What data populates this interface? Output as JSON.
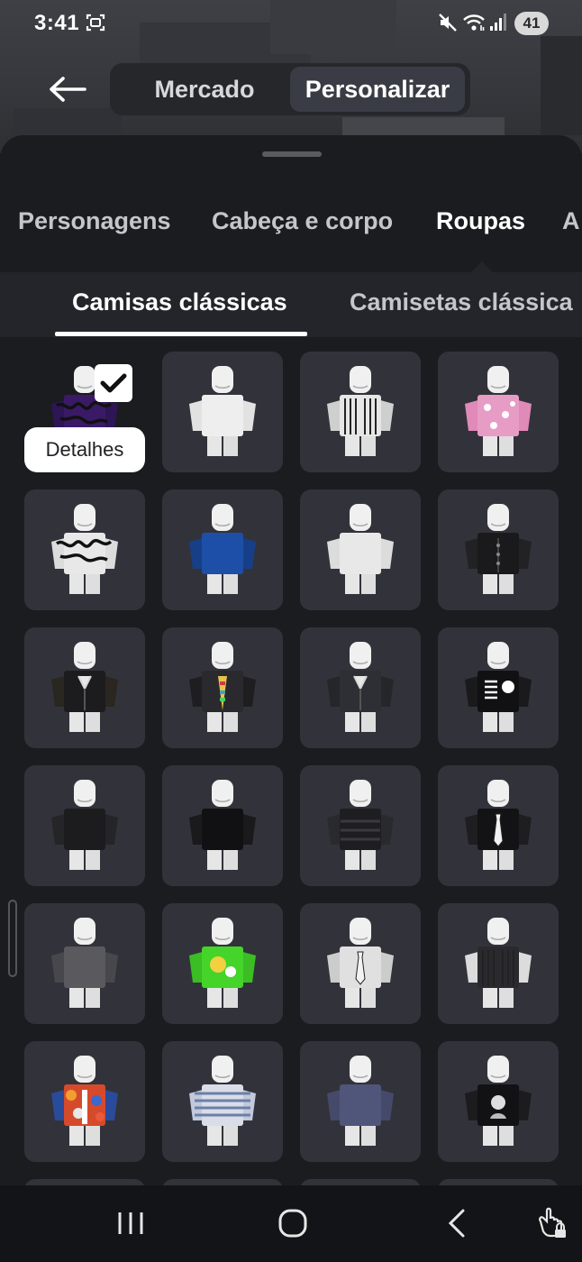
{
  "status_bar": {
    "time": "3:41",
    "battery": "41",
    "icons": [
      "screenshot-icon",
      "mute-icon",
      "wifi-icon",
      "signal-icon"
    ]
  },
  "header": {
    "tabs": [
      {
        "label": "Mercado",
        "active": false
      },
      {
        "label": "Personalizar",
        "active": true
      }
    ]
  },
  "categories": [
    {
      "label": "Personagens",
      "active": false
    },
    {
      "label": "Cabeça e corpo",
      "active": false
    },
    {
      "label": "Roupas",
      "active": true
    },
    {
      "label": "A",
      "active": false
    }
  ],
  "subcategories": [
    {
      "label": "Camisas clássicas",
      "active": true
    },
    {
      "label": "Camisetas clássica",
      "active": false
    }
  ],
  "tooltip": {
    "label": "Detalhes"
  },
  "items": [
    {
      "name": "purple-graffiti-shirt",
      "color": "#3a1a66",
      "arm": "#2e1555",
      "pattern": "graffiti",
      "selected": true
    },
    {
      "name": "plain-white-shirt",
      "color": "#eeeeee",
      "arm": "#e2e2e2",
      "pattern": "plain",
      "selected": false
    },
    {
      "name": "striped-bw-shirt",
      "color": "#e6e6e6",
      "arm": "#cfcfcf",
      "pattern": "stripes-dark",
      "selected": false
    },
    {
      "name": "pink-hello-kitty-shirt",
      "color": "#e79cc6",
      "arm": "#e08ab9",
      "pattern": "dots",
      "selected": false
    },
    {
      "name": "white-graffiti-shirt",
      "color": "#e8e8e8",
      "arm": "#dcdcdc",
      "pattern": "graffiti",
      "selected": false
    },
    {
      "name": "blue-jersey-shirt",
      "color": "#1e4fa8",
      "arm": "#173f88",
      "pattern": "plain",
      "selected": false
    },
    {
      "name": "white-henley-shirt",
      "color": "#e8e8e8",
      "arm": "#dcdcdc",
      "pattern": "plain",
      "selected": false
    },
    {
      "name": "black-cardigan-shirt",
      "color": "#1a1a1c",
      "arm": "#222225",
      "pattern": "buttons",
      "selected": false
    },
    {
      "name": "black-jacket-gold",
      "color": "#1c1c1e",
      "arm": "#2a2620",
      "pattern": "jacket",
      "selected": false
    },
    {
      "name": "black-leather-rainbow",
      "color": "#2a2a2e",
      "arm": "#1e1e20",
      "pattern": "rainbow",
      "selected": false
    },
    {
      "name": "dark-gray-jacket",
      "color": "#2e2f34",
      "arm": "#25262a",
      "pattern": "jacket",
      "selected": false
    },
    {
      "name": "real-men-kitty-shirt",
      "color": "#111113",
      "arm": "#1a1a1c",
      "pattern": "text",
      "selected": false
    },
    {
      "name": "black-hoodie",
      "color": "#1c1c1e",
      "arm": "#252528",
      "pattern": "plain",
      "selected": false
    },
    {
      "name": "black-tee-white-arms",
      "color": "#111113",
      "arm": "#1a1a1c",
      "pattern": "plain",
      "selected": false
    },
    {
      "name": "black-striped-sweater",
      "color": "#1e1e21",
      "arm": "#2a2a2e",
      "pattern": "stripes-light",
      "selected": false
    },
    {
      "name": "black-tie-vest",
      "color": "#131315",
      "arm": "#1e1e21",
      "pattern": "tie",
      "selected": false
    },
    {
      "name": "gray-sweater",
      "color": "#5a5a5e",
      "arm": "#48484c",
      "pattern": "plain",
      "selected": false
    },
    {
      "name": "green-cartoon-shirt",
      "color": "#44d42a",
      "arm": "#3bbd24",
      "pattern": "cartoon",
      "selected": false
    },
    {
      "name": "white-suit-tie",
      "color": "#e0e0e0",
      "arm": "#cccccc",
      "pattern": "tie",
      "selected": false
    },
    {
      "name": "black-white-striped-shirt",
      "color": "#2a2a2e",
      "arm": "#dcdcdc",
      "pattern": "stripes-dark",
      "selected": false
    },
    {
      "name": "floral-jacket",
      "color": "#d64a2c",
      "arm": "#2a4a9a",
      "pattern": "floral",
      "selected": false
    },
    {
      "name": "blue-white-stripes",
      "color": "#d8dde8",
      "arm": "#c2c9da",
      "pattern": "stripes-blue",
      "selected": false
    },
    {
      "name": "navy-knit-sweater",
      "color": "#50557a",
      "arm": "#454a6a",
      "pattern": "plain",
      "selected": false
    },
    {
      "name": "black-print-tee",
      "color": "#121214",
      "arm": "#1c1c1e",
      "pattern": "portrait",
      "selected": false
    }
  ],
  "navbar": [
    "recents-icon",
    "home-icon",
    "back-icon",
    "touch-lock-icon"
  ]
}
